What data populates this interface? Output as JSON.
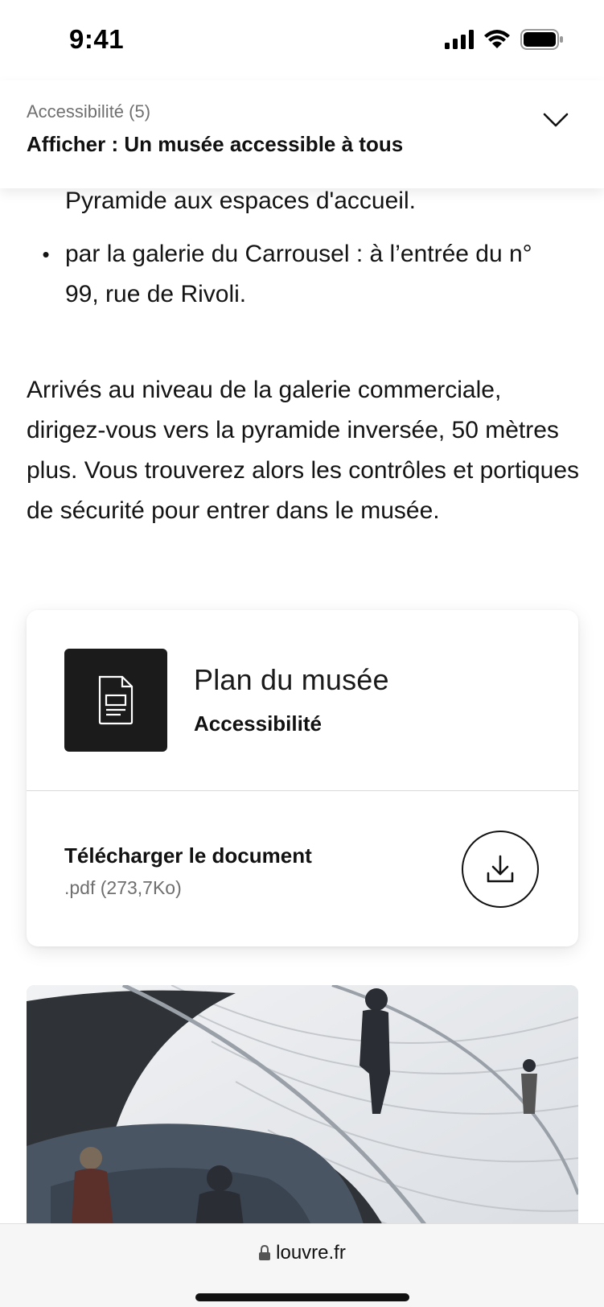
{
  "status_bar": {
    "time": "9:41"
  },
  "sticky_header": {
    "label": "Accessibilité (5)",
    "title": "Afficher : Un musée accessible à tous"
  },
  "content": {
    "bullets": [
      {
        "text": "ascenseur central (le \"tube\") conduit sous la Pyramide aux espaces d'accueil."
      },
      {
        "text": "par la galerie du Carrousel : à l’entrée du n° 99, rue de Rivoli."
      }
    ],
    "paragraph": "Arrivés au niveau de la galerie commerciale, dirigez-vous vers la pyramide inversée, 50 mètres plus. Vous trouverez alors les contrôles et portiques de sécurité pour entrer dans le musée."
  },
  "document_card": {
    "title": "Plan du musée",
    "subtitle": "Accessibilité",
    "download_label": "Télécharger le document",
    "file_meta": ".pdf (273,7Ko)",
    "icons": {
      "thumbnail": "document-icon",
      "download": "download-icon"
    }
  },
  "browser": {
    "url": "louvre.fr",
    "lock_icon": "lock-icon"
  },
  "colors": {
    "thumbnail_bg": "#1b1b1b",
    "text": "#141414",
    "muted": "#6f6f6f",
    "bottom_bar": "#f6f6f6"
  }
}
